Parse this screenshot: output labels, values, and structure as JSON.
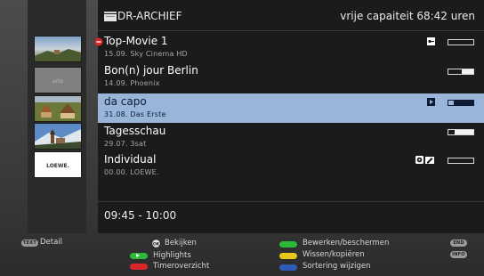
{
  "header": {
    "title": "DR-ARCHIEF",
    "capacity": "vrije capaiteit 68:42 uren"
  },
  "recordings": [
    {
      "title": "Top-Movie 1",
      "subtitle": "15.09.   Sky Cinema HD",
      "progress": 0.0,
      "flags": [
        "locked",
        "key"
      ]
    },
    {
      "title": "Bon(n) jour Berlin",
      "subtitle": "14.09.   Phoenix",
      "progress": 0.45,
      "flags": []
    },
    {
      "title": "da capo",
      "subtitle": "31.08.   Das Erste",
      "progress": 0.8,
      "flags": [
        "bookmark"
      ],
      "selected": true
    },
    {
      "title": "Tagesschau",
      "subtitle": "29.07.   3sat",
      "progress": 0.75,
      "flags": []
    },
    {
      "title": "Individual",
      "subtitle": "00.00.   LOEWE.",
      "progress": 0.0,
      "flags": [
        "disc",
        "edit"
      ]
    }
  ],
  "thumbnails": [
    "landscape",
    "grey",
    "wooden-houses",
    "mountain-church",
    "loewe-logo"
  ],
  "thumbnail_text": {
    "thumb2": "arte",
    "thumb5": "LOEWE."
  },
  "time_range": "09:45 - 10:00",
  "legend": {
    "detail_key": "TEXT",
    "detail": "Detail",
    "play": "Bekijken",
    "highlights": "Highlights",
    "timer": "Timeroverzicht",
    "edit": "Bewerken/beschermen",
    "copy": "Wissen/kopiëren",
    "sort": "Sortering wijzigen",
    "end_key": "END",
    "info_key": "INFO"
  },
  "colors": {
    "selected_row": "#9ab5da",
    "green": "#2db93a",
    "red": "#d8262b",
    "yellow": "#e6c619",
    "blue": "#2e5bb8"
  }
}
